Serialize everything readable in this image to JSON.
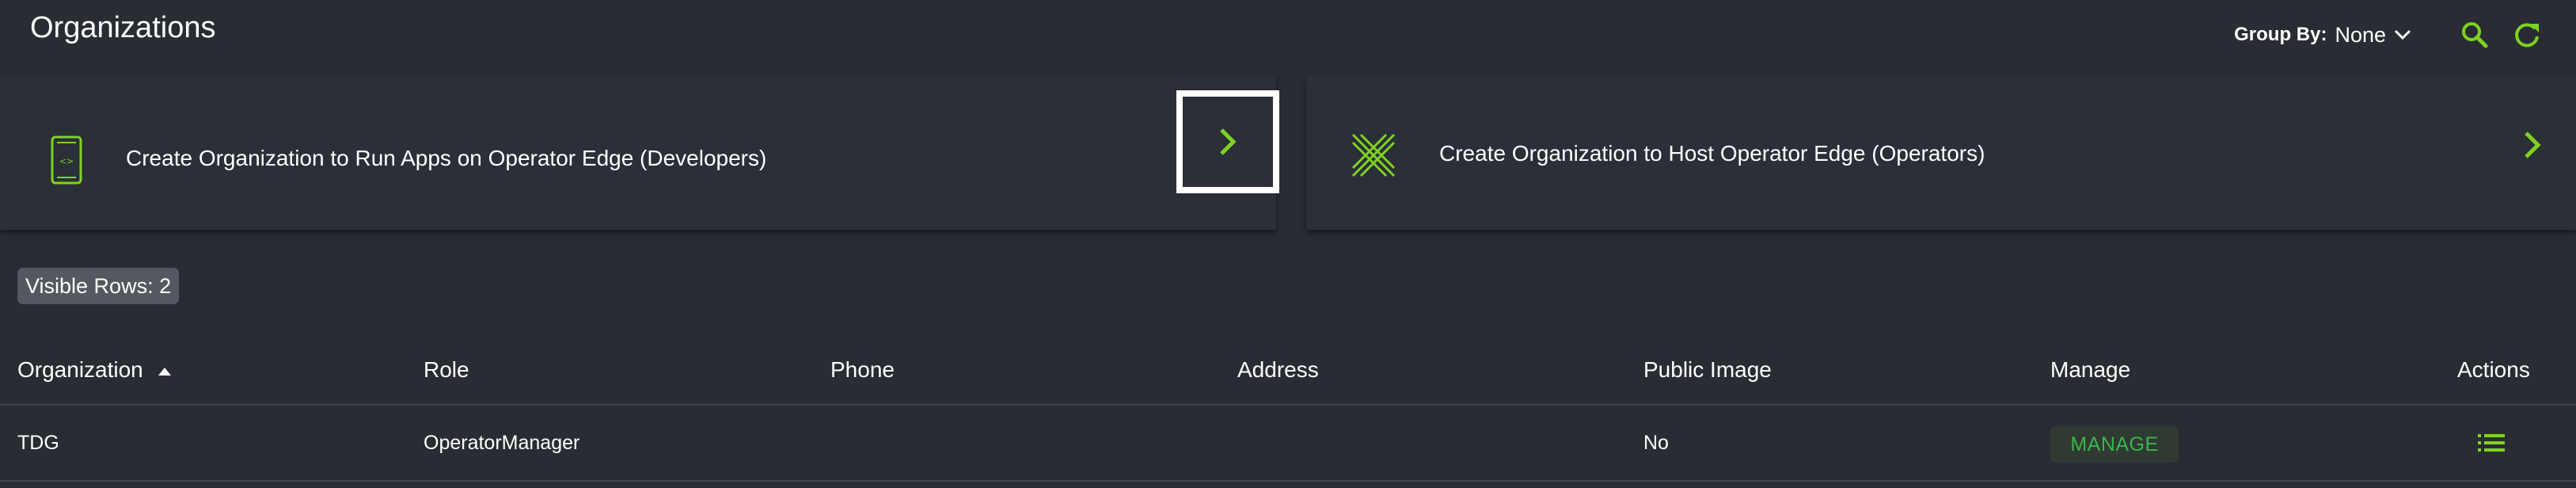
{
  "header": {
    "title": "Organizations",
    "group_by_label": "Group By:",
    "group_by_value": "None"
  },
  "cards": {
    "developer_text": "Create Organization to Run Apps on Operator Edge (Developers)",
    "operator_text": "Create Organization to Host Operator Edge (Operators)"
  },
  "visible_rows": "Visible Rows: 2",
  "table": {
    "columns": [
      "Organization",
      "Role",
      "Phone",
      "Address",
      "Public Image",
      "Manage",
      "Actions"
    ],
    "rows": [
      {
        "organization": "TDG",
        "role": "OperatorManager",
        "phone": "",
        "address": "",
        "public_image": "No",
        "manage": "MANAGE"
      }
    ]
  },
  "icons": {
    "group_by_dropdown": "chevron-down-icon",
    "search": "search-icon",
    "refresh": "refresh-icon",
    "developer_card": "mobile-device-icon",
    "operator_card": "operator-logo-icon",
    "card_arrow": "chevron-right-icon",
    "sort": "sort-ascending-icon",
    "actions": "list-icon"
  },
  "colors": {
    "background": "#292c33",
    "accent": "#7ed321",
    "manage_text": "#3bb54a"
  }
}
